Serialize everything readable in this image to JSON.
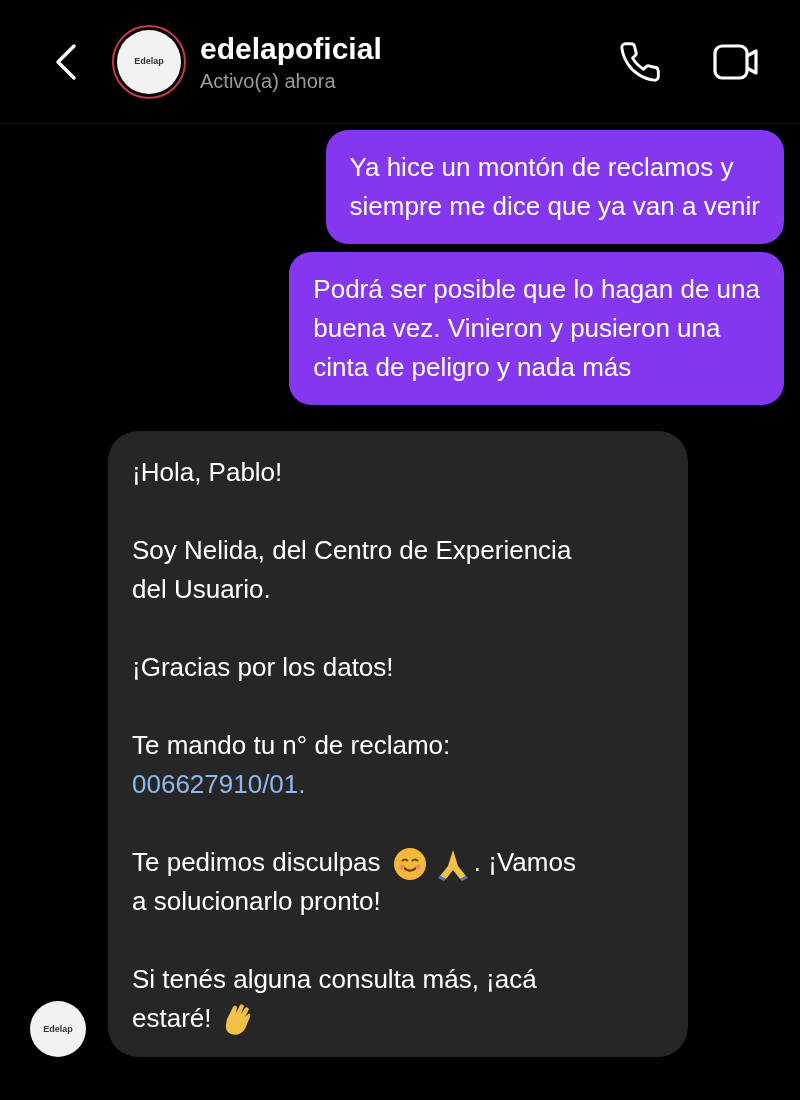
{
  "header": {
    "avatar_label": "Edelap",
    "username": "edelapoficial",
    "status": "Activo(a) ahora"
  },
  "sent_messages": [
    {
      "text": "Ya hice un montón de reclamos y\nsiempre me dice que ya van a venir"
    },
    {
      "text": "Podrá ser posible que lo hagan de una\nbuena vez. Vinieron y pusieron una\ncinta de peligro y nada más"
    }
  ],
  "received_message": {
    "avatar_label": "Edelap",
    "paragraphs": [
      [
        {
          "kind": "text",
          "text": "¡Hola, Pablo!"
        }
      ],
      [
        {
          "kind": "text",
          "text": "Soy Nelida, del Centro de Experiencia\ndel Usuario."
        }
      ],
      [
        {
          "kind": "text",
          "text": "¡Gracias por los datos!"
        }
      ],
      [
        {
          "kind": "text",
          "text": "Te mando tu n° de reclamo:\n"
        },
        {
          "kind": "link",
          "text": "006627910/01."
        }
      ],
      [
        {
          "kind": "text",
          "text": "Te pedimos disculpas "
        },
        {
          "kind": "smile"
        },
        {
          "kind": "pray"
        },
        {
          "kind": "text",
          "text": ". ¡Vamos\na solucionarlo pronto!"
        }
      ],
      [
        {
          "kind": "text",
          "text": "Si tenés alguna consulta más, ¡acá\nestaré! "
        },
        {
          "kind": "wave"
        }
      ]
    ]
  }
}
